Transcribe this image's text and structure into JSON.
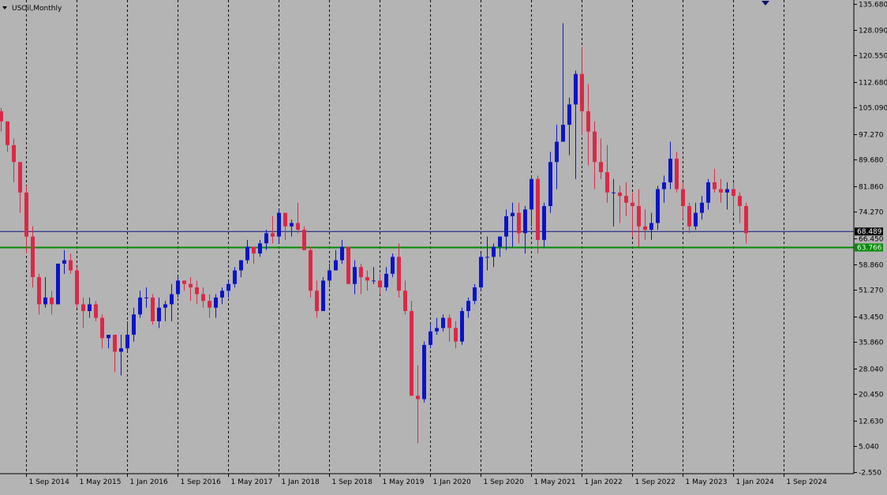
{
  "symbol_label": "USOil,Monthly",
  "colors": {
    "background": "#b4b4b4",
    "bull": "#0a14c8",
    "bear": "#dc2846",
    "grid": "#000000",
    "current_line": "#0a147a",
    "support_line": "#008c00",
    "current_tag_bg": "#000000",
    "support_tag_bg": "#008c00"
  },
  "y_axis": {
    "ticks": [
      "135.680",
      "128.090",
      "120.550",
      "112.680",
      "105.090",
      "97.270",
      "89.680",
      "81.860",
      "74.270",
      "66.450",
      "58.860",
      "51.270",
      "43.450",
      "35.860",
      "28.040",
      "20.450",
      "12.630",
      "5.040",
      "-2.550"
    ],
    "min": -2.55,
    "max": 135.68
  },
  "x_axis": {
    "ticks": [
      "1 Sep 2014",
      "1 May 2015",
      "1 Jan 2016",
      "1 Sep 2016",
      "1 May 2017",
      "1 Jan 2018",
      "1 Sep 2018",
      "1 May 2019",
      "1 Jan 2020",
      "1 Sep 2020",
      "1 May 2021",
      "1 Jan 2022",
      "1 Sep 2022",
      "1 May 2023",
      "1 Jan 2024",
      "1 Sep 2024"
    ]
  },
  "price_tags": {
    "current": "68.489",
    "support": "63.766"
  },
  "chart_data": {
    "type": "candlestick",
    "title": "USOil,Monthly",
    "series_start": "Jul 2014",
    "period": "monthly",
    "ylim": [
      -2.55,
      135.68
    ],
    "current_price": 68.489,
    "horizontal_lines": [
      68.489,
      63.766
    ],
    "grid": "vertical dashed",
    "candles": [
      [
        104,
        105,
        98,
        101
      ],
      [
        101,
        101,
        92,
        94
      ],
      [
        94,
        96,
        83,
        89
      ],
      [
        89,
        89,
        74,
        80
      ],
      [
        80,
        82,
        62,
        67
      ],
      [
        67,
        70,
        52,
        55
      ],
      [
        55,
        56,
        44,
        47
      ],
      [
        47,
        55,
        46,
        49
      ],
      [
        49,
        51,
        44,
        47
      ],
      [
        47,
        59,
        47,
        59
      ],
      [
        59,
        63,
        56,
        60
      ],
      [
        60,
        62,
        56,
        57
      ],
      [
        57,
        58,
        46,
        47
      ],
      [
        47,
        49,
        40,
        45
      ],
      [
        45,
        49,
        43,
        47
      ],
      [
        47,
        48,
        42,
        43
      ],
      [
        43,
        44,
        34,
        37
      ],
      [
        37,
        38,
        34,
        38
      ],
      [
        38,
        38,
        27,
        33
      ],
      [
        33,
        38,
        26,
        34
      ],
      [
        34,
        42,
        33,
        38
      ],
      [
        38,
        46,
        36,
        44
      ],
      [
        44,
        51,
        43,
        49
      ],
      [
        49,
        52,
        46,
        49
      ],
      [
        49,
        50,
        41,
        42
      ],
      [
        42,
        49,
        40,
        46
      ],
      [
        46,
        48,
        42,
        47
      ],
      [
        47,
        53,
        42,
        50
      ],
      [
        50,
        55,
        49,
        54
      ],
      [
        54,
        54,
        51,
        53
      ],
      [
        53,
        55,
        48,
        52
      ],
      [
        52,
        54,
        47,
        50
      ],
      [
        50,
        52,
        46,
        48
      ],
      [
        48,
        50,
        43,
        46
      ],
      [
        46,
        50,
        43,
        49
      ],
      [
        49,
        52,
        47,
        51
      ],
      [
        51,
        54,
        49,
        53
      ],
      [
        53,
        58,
        52,
        57
      ],
      [
        57,
        60,
        55,
        60
      ],
      [
        60,
        66,
        59,
        64
      ],
      [
        64,
        64,
        59,
        62
      ],
      [
        62,
        66,
        61,
        65
      ],
      [
        65,
        69,
        63,
        68
      ],
      [
        68,
        73,
        65,
        67
      ],
      [
        67,
        75,
        65,
        74
      ],
      [
        74,
        74,
        66,
        70
      ],
      [
        70,
        72,
        67,
        71
      ],
      [
        71,
        77,
        68,
        69
      ],
      [
        69,
        70,
        63,
        63
      ],
      [
        63,
        64,
        49,
        51
      ],
      [
        51,
        54,
        43,
        45
      ],
      [
        45,
        55,
        45,
        54
      ],
      [
        54,
        59,
        52,
        57
      ],
      [
        57,
        63,
        57,
        60
      ],
      [
        60,
        66,
        59,
        64
      ],
      [
        64,
        64,
        53,
        53
      ],
      [
        53,
        60,
        50,
        58
      ],
      [
        58,
        59,
        50,
        55
      ],
      [
        55,
        57,
        51,
        54
      ],
      [
        54,
        58,
        53,
        54
      ],
      [
        54,
        56,
        50,
        52
      ],
      [
        52,
        58,
        51,
        56
      ],
      [
        56,
        62,
        55,
        61
      ],
      [
        61,
        65,
        49,
        51
      ],
      [
        51,
        54,
        44,
        45
      ],
      [
        45,
        48,
        20,
        20
      ],
      [
        20,
        29,
        6,
        19
      ],
      [
        19,
        36,
        18,
        35
      ],
      [
        35,
        41,
        34,
        39
      ],
      [
        39,
        43,
        38,
        40
      ],
      [
        40,
        44,
        39,
        43
      ],
      [
        43,
        44,
        36,
        40
      ],
      [
        40,
        42,
        34,
        36
      ],
      [
        36,
        46,
        35,
        45
      ],
      [
        45,
        49,
        43,
        48
      ],
      [
        48,
        53,
        47,
        52
      ],
      [
        52,
        62,
        51,
        61
      ],
      [
        61,
        67,
        57,
        61
      ],
      [
        61,
        65,
        58,
        64
      ],
      [
        64,
        67,
        61,
        67
      ],
      [
        67,
        75,
        63,
        73
      ],
      [
        73,
        77,
        64,
        74
      ],
      [
        74,
        77,
        65,
        68
      ],
      [
        68,
        76,
        62,
        75
      ],
      [
        75,
        85,
        70,
        84
      ],
      [
        84,
        85,
        62,
        66
      ],
      [
        66,
        77,
        64,
        76
      ],
      [
        76,
        92,
        74,
        89
      ],
      [
        89,
        100,
        81,
        95
      ],
      [
        95,
        130,
        95,
        100
      ],
      [
        100,
        108,
        91,
        106
      ],
      [
        106,
        116,
        84,
        115
      ],
      [
        115,
        123,
        97,
        104
      ],
      [
        104,
        112,
        88,
        98
      ],
      [
        98,
        101,
        81,
        89
      ],
      [
        89,
        96,
        84,
        86
      ],
      [
        86,
        94,
        77,
        80
      ],
      [
        80,
        84,
        70,
        80
      ],
      [
        80,
        82,
        71,
        79
      ],
      [
        79,
        83,
        73,
        77
      ],
      [
        77,
        80,
        67,
        76
      ],
      [
        76,
        81,
        64,
        70
      ],
      [
        70,
        75,
        66,
        69
      ],
      [
        69,
        74,
        66,
        71
      ],
      [
        71,
        82,
        69,
        81
      ],
      [
        81,
        85,
        77,
        83
      ],
      [
        83,
        95,
        81,
        90
      ],
      [
        90,
        92,
        80,
        81
      ],
      [
        81,
        83,
        72,
        76
      ],
      [
        76,
        77,
        68,
        70
      ],
      [
        70,
        77,
        69,
        74
      ],
      [
        74,
        79,
        72,
        77
      ],
      [
        77,
        84,
        75,
        83
      ],
      [
        83,
        87,
        80,
        81
      ],
      [
        81,
        84,
        77,
        80
      ],
      [
        80,
        83,
        75,
        81
      ],
      [
        81,
        83,
        74,
        79
      ],
      [
        79,
        80,
        71,
        76
      ],
      [
        76,
        77,
        65,
        68
      ]
    ]
  }
}
